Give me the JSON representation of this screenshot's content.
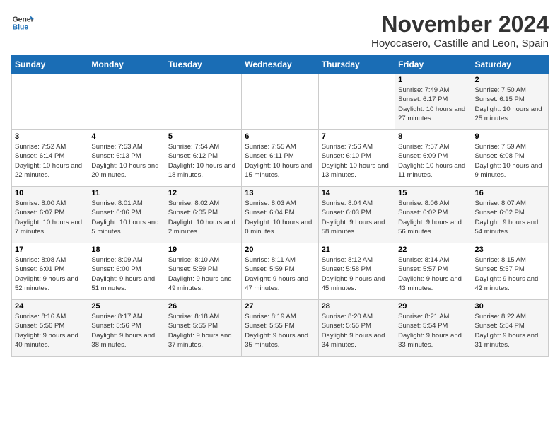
{
  "header": {
    "logo_line1": "General",
    "logo_line2": "Blue",
    "title": "November 2024",
    "location": "Hoyocasero, Castille and Leon, Spain"
  },
  "days_of_week": [
    "Sunday",
    "Monday",
    "Tuesday",
    "Wednesday",
    "Thursday",
    "Friday",
    "Saturday"
  ],
  "weeks": [
    [
      {
        "day": "",
        "info": ""
      },
      {
        "day": "",
        "info": ""
      },
      {
        "day": "",
        "info": ""
      },
      {
        "day": "",
        "info": ""
      },
      {
        "day": "",
        "info": ""
      },
      {
        "day": "1",
        "info": "Sunrise: 7:49 AM\nSunset: 6:17 PM\nDaylight: 10 hours and 27 minutes."
      },
      {
        "day": "2",
        "info": "Sunrise: 7:50 AM\nSunset: 6:15 PM\nDaylight: 10 hours and 25 minutes."
      }
    ],
    [
      {
        "day": "3",
        "info": "Sunrise: 7:52 AM\nSunset: 6:14 PM\nDaylight: 10 hours and 22 minutes."
      },
      {
        "day": "4",
        "info": "Sunrise: 7:53 AM\nSunset: 6:13 PM\nDaylight: 10 hours and 20 minutes."
      },
      {
        "day": "5",
        "info": "Sunrise: 7:54 AM\nSunset: 6:12 PM\nDaylight: 10 hours and 18 minutes."
      },
      {
        "day": "6",
        "info": "Sunrise: 7:55 AM\nSunset: 6:11 PM\nDaylight: 10 hours and 15 minutes."
      },
      {
        "day": "7",
        "info": "Sunrise: 7:56 AM\nSunset: 6:10 PM\nDaylight: 10 hours and 13 minutes."
      },
      {
        "day": "8",
        "info": "Sunrise: 7:57 AM\nSunset: 6:09 PM\nDaylight: 10 hours and 11 minutes."
      },
      {
        "day": "9",
        "info": "Sunrise: 7:59 AM\nSunset: 6:08 PM\nDaylight: 10 hours and 9 minutes."
      }
    ],
    [
      {
        "day": "10",
        "info": "Sunrise: 8:00 AM\nSunset: 6:07 PM\nDaylight: 10 hours and 7 minutes."
      },
      {
        "day": "11",
        "info": "Sunrise: 8:01 AM\nSunset: 6:06 PM\nDaylight: 10 hours and 5 minutes."
      },
      {
        "day": "12",
        "info": "Sunrise: 8:02 AM\nSunset: 6:05 PM\nDaylight: 10 hours and 2 minutes."
      },
      {
        "day": "13",
        "info": "Sunrise: 8:03 AM\nSunset: 6:04 PM\nDaylight: 10 hours and 0 minutes."
      },
      {
        "day": "14",
        "info": "Sunrise: 8:04 AM\nSunset: 6:03 PM\nDaylight: 9 hours and 58 minutes."
      },
      {
        "day": "15",
        "info": "Sunrise: 8:06 AM\nSunset: 6:02 PM\nDaylight: 9 hours and 56 minutes."
      },
      {
        "day": "16",
        "info": "Sunrise: 8:07 AM\nSunset: 6:02 PM\nDaylight: 9 hours and 54 minutes."
      }
    ],
    [
      {
        "day": "17",
        "info": "Sunrise: 8:08 AM\nSunset: 6:01 PM\nDaylight: 9 hours and 52 minutes."
      },
      {
        "day": "18",
        "info": "Sunrise: 8:09 AM\nSunset: 6:00 PM\nDaylight: 9 hours and 51 minutes."
      },
      {
        "day": "19",
        "info": "Sunrise: 8:10 AM\nSunset: 5:59 PM\nDaylight: 9 hours and 49 minutes."
      },
      {
        "day": "20",
        "info": "Sunrise: 8:11 AM\nSunset: 5:59 PM\nDaylight: 9 hours and 47 minutes."
      },
      {
        "day": "21",
        "info": "Sunrise: 8:12 AM\nSunset: 5:58 PM\nDaylight: 9 hours and 45 minutes."
      },
      {
        "day": "22",
        "info": "Sunrise: 8:14 AM\nSunset: 5:57 PM\nDaylight: 9 hours and 43 minutes."
      },
      {
        "day": "23",
        "info": "Sunrise: 8:15 AM\nSunset: 5:57 PM\nDaylight: 9 hours and 42 minutes."
      }
    ],
    [
      {
        "day": "24",
        "info": "Sunrise: 8:16 AM\nSunset: 5:56 PM\nDaylight: 9 hours and 40 minutes."
      },
      {
        "day": "25",
        "info": "Sunrise: 8:17 AM\nSunset: 5:56 PM\nDaylight: 9 hours and 38 minutes."
      },
      {
        "day": "26",
        "info": "Sunrise: 8:18 AM\nSunset: 5:55 PM\nDaylight: 9 hours and 37 minutes."
      },
      {
        "day": "27",
        "info": "Sunrise: 8:19 AM\nSunset: 5:55 PM\nDaylight: 9 hours and 35 minutes."
      },
      {
        "day": "28",
        "info": "Sunrise: 8:20 AM\nSunset: 5:55 PM\nDaylight: 9 hours and 34 minutes."
      },
      {
        "day": "29",
        "info": "Sunrise: 8:21 AM\nSunset: 5:54 PM\nDaylight: 9 hours and 33 minutes."
      },
      {
        "day": "30",
        "info": "Sunrise: 8:22 AM\nSunset: 5:54 PM\nDaylight: 9 hours and 31 minutes."
      }
    ]
  ]
}
